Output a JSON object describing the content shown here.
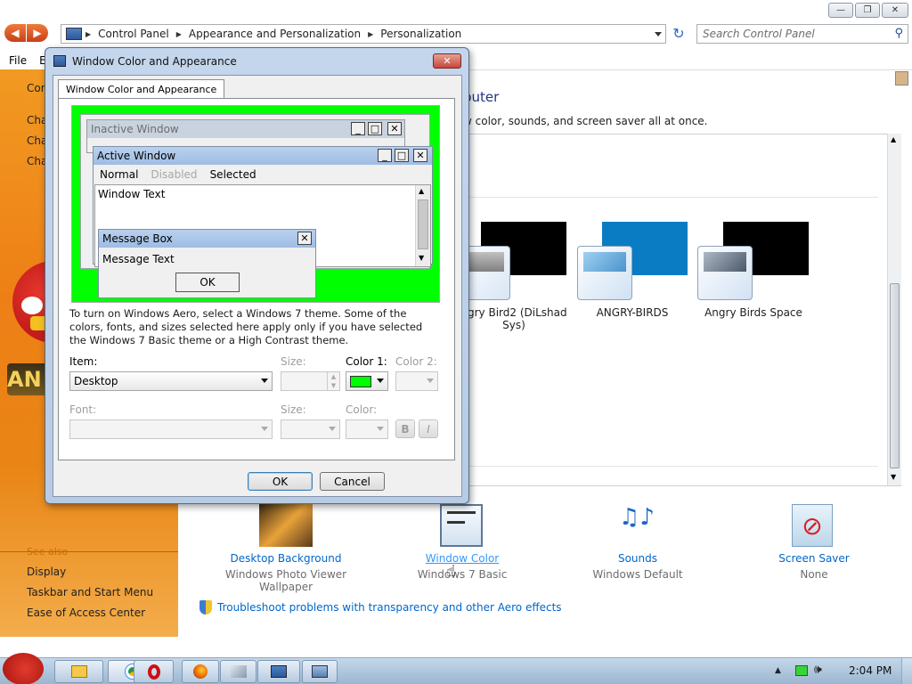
{
  "window": {
    "breadcrumb": [
      "Control Panel",
      "Appearance and Personalization",
      "Personalization"
    ],
    "search_placeholder": "Search Control Panel",
    "menu": [
      "File",
      "E"
    ]
  },
  "left_pane": {
    "top_links": [
      "Con",
      "Cha",
      "Cha",
      "Cha"
    ],
    "see_also": "See also",
    "links": [
      "Display",
      "Taskbar and Start Menu",
      "Ease of Access Center"
    ]
  },
  "main": {
    "heading_partial": "puter",
    "subheading_partial": "w color, sounds, and screen saver all at once.",
    "themes": [
      {
        "label": "ngry Bird2 (DiLshad Sys)",
        "color": "#000000"
      },
      {
        "label": "ANGRY-BIRDS",
        "color": "#0a7cc4"
      },
      {
        "label": "Angry Birds Space",
        "color": "#000000"
      }
    ],
    "bottom_items": [
      {
        "title": "Desktop Background",
        "sub": "Windows Photo Viewer Wallpaper"
      },
      {
        "title": "Window Color",
        "sub": "Windows 7 Basic"
      },
      {
        "title": "Sounds",
        "sub": "Windows Default"
      },
      {
        "title": "Screen Saver",
        "sub": "None"
      }
    ],
    "troubleshoot_link": "Troubleshoot problems with transparency and other Aero effects"
  },
  "dialog": {
    "title": "Window Color and Appearance",
    "tab": "Window Color and Appearance",
    "preview": {
      "inactive_title": "Inactive Window",
      "active_title": "Active Window",
      "menu_normal": "Normal",
      "menu_disabled": "Disabled",
      "menu_selected": "Selected",
      "window_text": "Window Text",
      "msgbox_title": "Message Box",
      "msgbox_text": "Message Text",
      "msgbox_ok": "OK",
      "desktop_color": "#00ff00"
    },
    "info_text": "To turn on Windows Aero, select a Windows 7 theme.  Some of the colors, fonts, and sizes selected here apply only if you have selected the Windows 7 Basic theme or a High Contrast theme.",
    "item_label": "Item:",
    "item_value": "Desktop",
    "size_label": "Size:",
    "color1_label": "Color 1:",
    "color1_value": "#00ff00",
    "color2_label": "Color 2:",
    "font_label": "Font:",
    "font_size_label": "Size:",
    "font_color_label": "Color:",
    "bold": "B",
    "italic": "I",
    "ok": "OK",
    "cancel": "Cancel"
  },
  "taskbar": {
    "clock": "2:04 PM"
  }
}
